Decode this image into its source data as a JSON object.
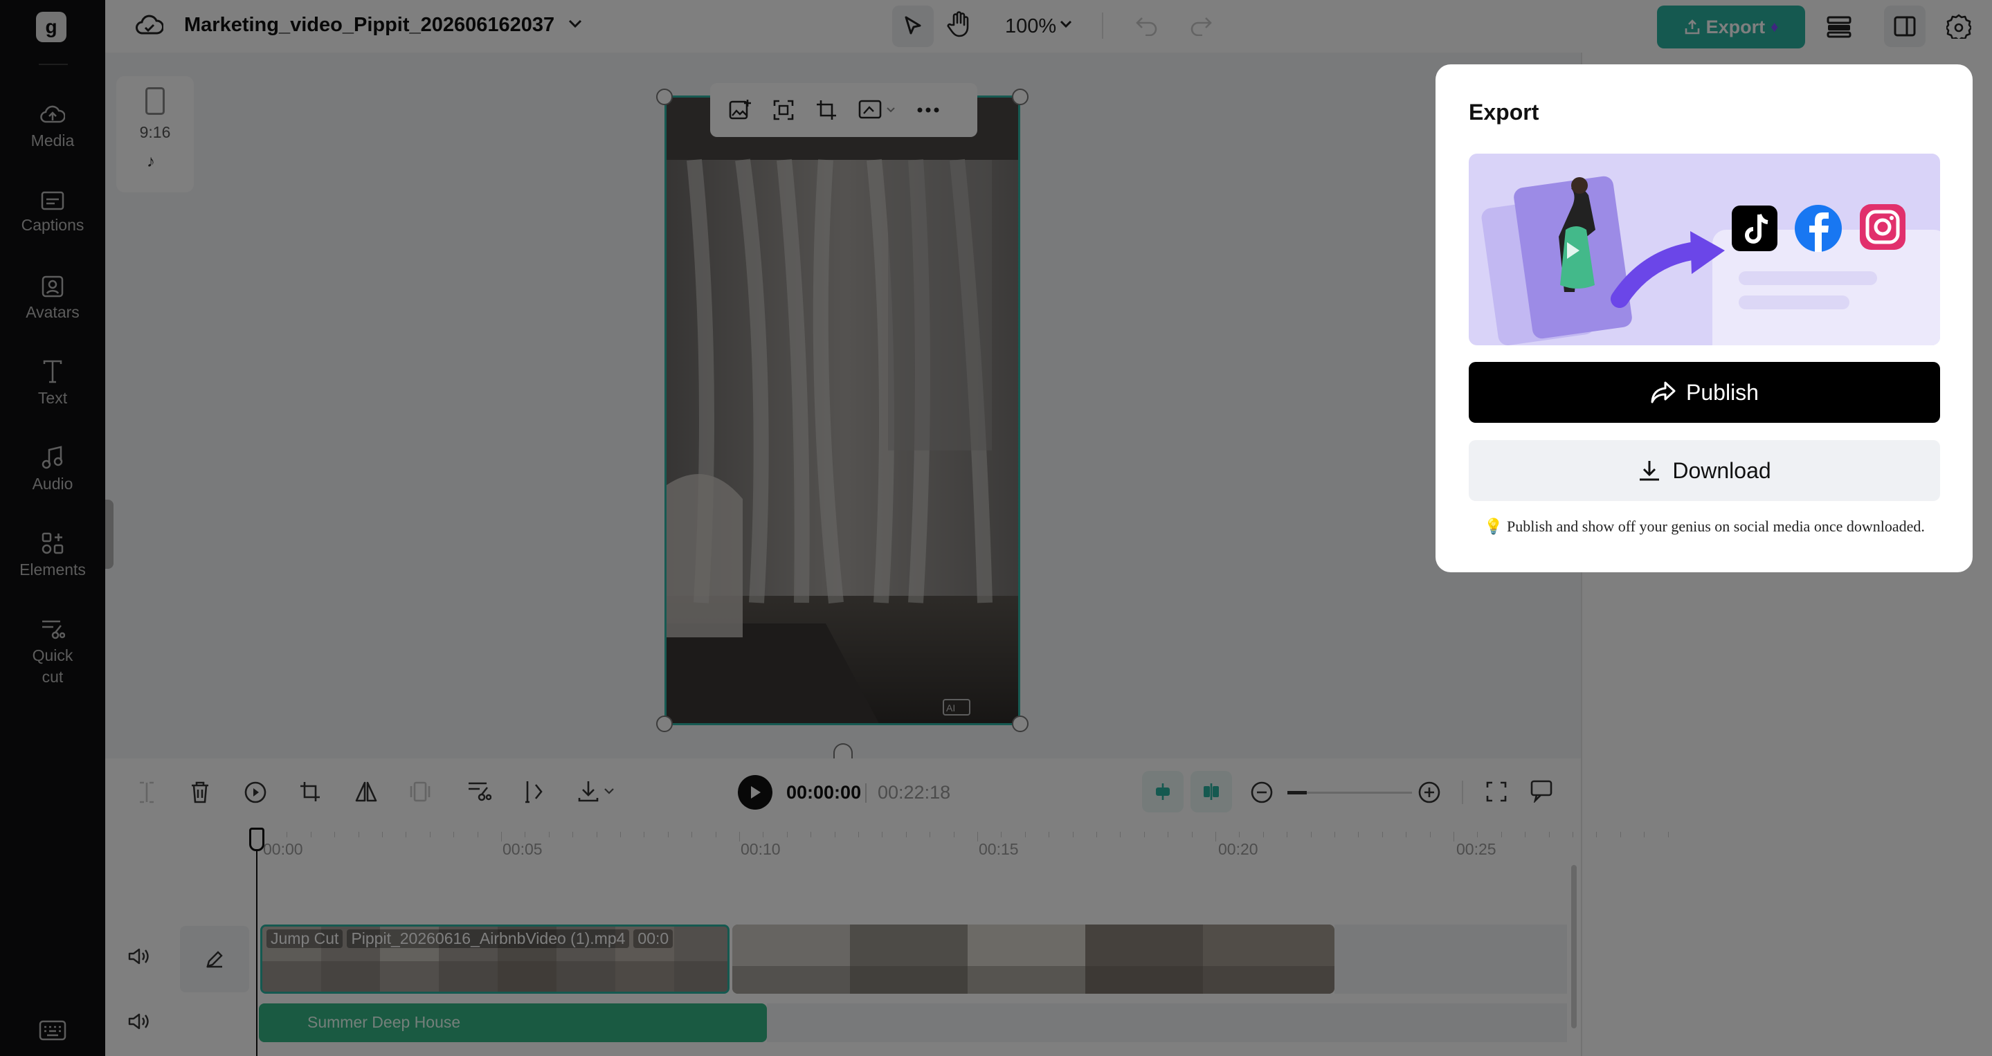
{
  "header": {
    "project_title": "Marketing_video_Pippit_202606162037",
    "zoom": "100%",
    "export_label": "Export"
  },
  "sidebar": {
    "logo": "g",
    "items": [
      {
        "label": "Media",
        "icon": "cloud-upload-icon"
      },
      {
        "label": "Captions",
        "icon": "captions-icon"
      },
      {
        "label": "Avatars",
        "icon": "avatar-icon"
      },
      {
        "label": "Text",
        "icon": "text-icon"
      },
      {
        "label": "Audio",
        "icon": "music-note-icon"
      },
      {
        "label": "Elements",
        "icon": "elements-icon"
      },
      {
        "label": "Quick\ncut",
        "icon": "quick-cut-icon"
      }
    ]
  },
  "canvas": {
    "ratio_label": "9:16",
    "ai_badge": "AI"
  },
  "playback": {
    "current_time": "00:00:00",
    "total_time": "00:22:18"
  },
  "timeline": {
    "ruler": [
      "00:00",
      "00:05",
      "00:10",
      "00:15",
      "00:20",
      "00:25"
    ],
    "video_clip_tag": "Jump Cut",
    "video_clip_name": "Pippit_20260616_AirbnbVideo (1).mp4",
    "video_clip_time": "00:0",
    "audio_clip_name": "Summer Deep House"
  },
  "export_popup": {
    "title": "Export",
    "publish_label": "Publish",
    "download_label": "Download",
    "hint": "💡 Publish and show off your genius on social media once downloaded."
  },
  "colors": {
    "sidebar_bg": "#0f0f10",
    "export_button": "#2bb3a0",
    "audio_clip": "#35b484",
    "banner_bg": "#d9d3f8",
    "arrow_purple": "#6b46e8"
  }
}
